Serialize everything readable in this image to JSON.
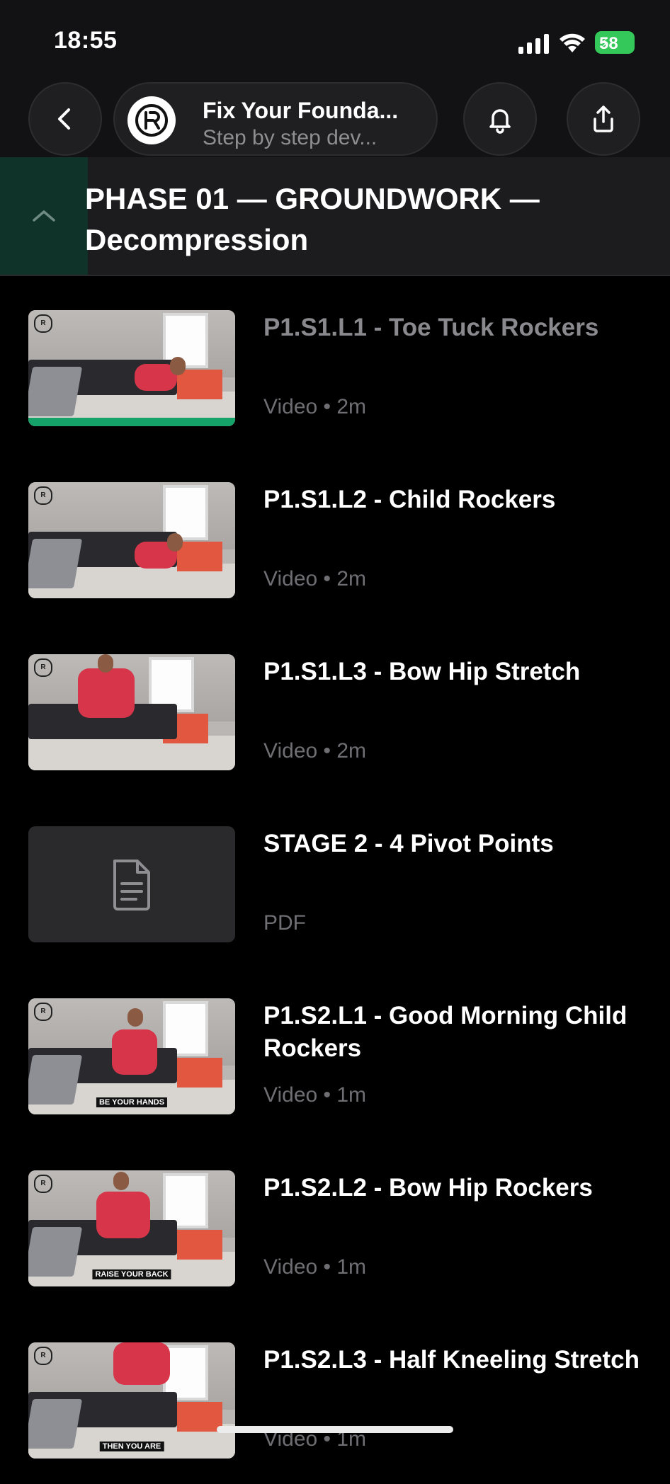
{
  "status_bar": {
    "time": "18:55",
    "battery": "58"
  },
  "header": {
    "course_title": "Fix Your Founda...",
    "course_subtitle": "Step by step dev..."
  },
  "section": {
    "title": "PHASE 01 — GROUNDWORK — Decompression"
  },
  "lessons": [
    {
      "title": "P1.S1.L1 - Toe Tuck Rockers",
      "meta": "Video • 2m",
      "completed": true
    },
    {
      "title": "P1.S1.L2 - Child Rockers",
      "meta": "Video • 2m",
      "completed": false
    },
    {
      "title": "P1.S1.L3 - Bow Hip Stretch",
      "meta": "Video • 2m",
      "completed": false
    },
    {
      "title": "STAGE 2 - 4 Pivot Points",
      "meta": "PDF",
      "completed": false
    },
    {
      "title": "P1.S2.L1 - Good Morning Child Rockers",
      "meta": "Video • 1m",
      "completed": false,
      "caption": "BE YOUR HANDS"
    },
    {
      "title": "P1.S2.L2 - Bow Hip Rockers",
      "meta": "Video • 1m",
      "completed": false,
      "caption": "RAISE YOUR BACK"
    },
    {
      "title": "P1.S2.L3 - Half Kneeling Stretch",
      "meta": "Video • 1m",
      "completed": false,
      "caption": "THEN YOU ARE"
    }
  ],
  "colors": {
    "accent_green": "#16a36a",
    "section_collapse_bg": "#0f3328"
  },
  "icons": [
    "back-icon",
    "course-logo-icon",
    "bell-icon",
    "share-icon",
    "chevron-up-icon",
    "document-icon"
  ]
}
